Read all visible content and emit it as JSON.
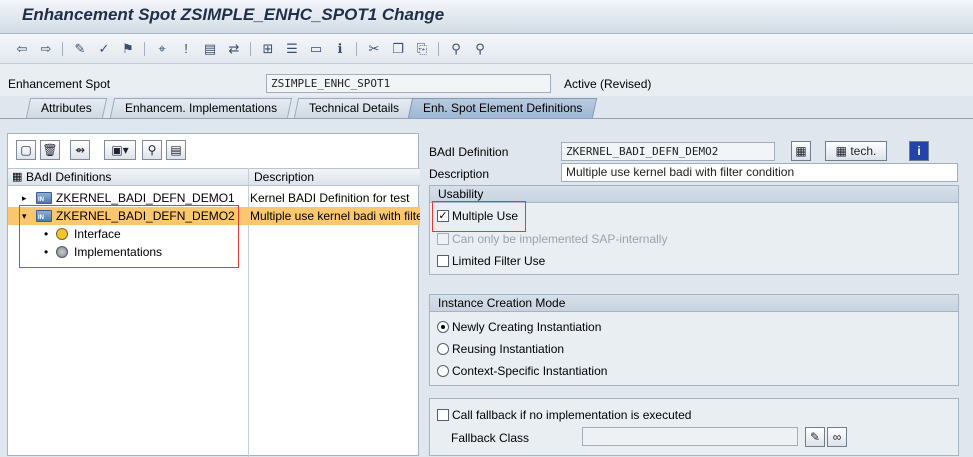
{
  "window": {
    "title": "Enhancement Spot ZSIMPLE_ENHC_SPOT1 Change"
  },
  "toolbar": {
    "icons": [
      "back-arrow-icon",
      "forward-arrow-icon",
      "edit-toggle-icon",
      "check-icon",
      "activate-icon",
      "where-used-icon",
      "info-pin-icon",
      "display-object-icon",
      "navigate-icon",
      "hierarchy-icon",
      "list-icon",
      "window-icon",
      "info-icon",
      "cut-icon",
      "copy-icon",
      "paste-icon",
      "find-icon",
      "find-next-icon"
    ]
  },
  "header": {
    "enh_spot_label": "Enhancement Spot",
    "enh_spot_value": "ZSIMPLE_ENHC_SPOT1",
    "status": "Active (Revised)"
  },
  "tabs": [
    {
      "label": "Attributes",
      "active": false
    },
    {
      "label": "Enhancem. Implementations",
      "active": false
    },
    {
      "label": "Technical Details",
      "active": false
    },
    {
      "label": "Enh. Spot Element Definitions",
      "active": true
    }
  ],
  "tree": {
    "col_name": "BAdI Definitions",
    "col_desc": "Description",
    "rows": [
      {
        "name": "ZKERNEL_BADI_DEFN_DEMO1",
        "desc": "Kernel BADI Definition for test",
        "expanded": false,
        "selected": false
      },
      {
        "name": "ZKERNEL_BADI_DEFN_DEMO2",
        "desc": "Multiple use kernel badi with filter condition",
        "expanded": true,
        "selected": true
      }
    ],
    "children": [
      {
        "name": "Interface"
      },
      {
        "name": "Implementations"
      }
    ]
  },
  "detail": {
    "badi_def_label": "BAdI Definition",
    "badi_def_value": "ZKERNEL_BADI_DEFN_DEMO2",
    "tech_button": "tech.",
    "desc_label": "Description",
    "desc_value": "Multiple use kernel badi with filter condition"
  },
  "usability": {
    "title": "Usability",
    "multiple_use": {
      "label": "Multiple Use",
      "checked": true
    },
    "sap_internal": {
      "label": "Can only be implemented SAP-internally",
      "checked": false,
      "disabled": true
    },
    "limited_filter": {
      "label": "Limited Filter Use",
      "checked": false
    }
  },
  "instance": {
    "title": "Instance Creation Mode",
    "options": [
      {
        "label": "Newly Creating Instantiation",
        "selected": true
      },
      {
        "label": "Reusing Instantiation",
        "selected": false
      },
      {
        "label": "Context-Specific Instantiation",
        "selected": false
      }
    ]
  },
  "fallback": {
    "call_label": "Call fallback if no implementation is executed",
    "checked": false,
    "class_label": "Fallback Class",
    "class_value": ""
  },
  "colors": {
    "selected_row": "#f9c76d",
    "annotation_red": "#e53b3b",
    "title_color": "#1f2f47"
  }
}
